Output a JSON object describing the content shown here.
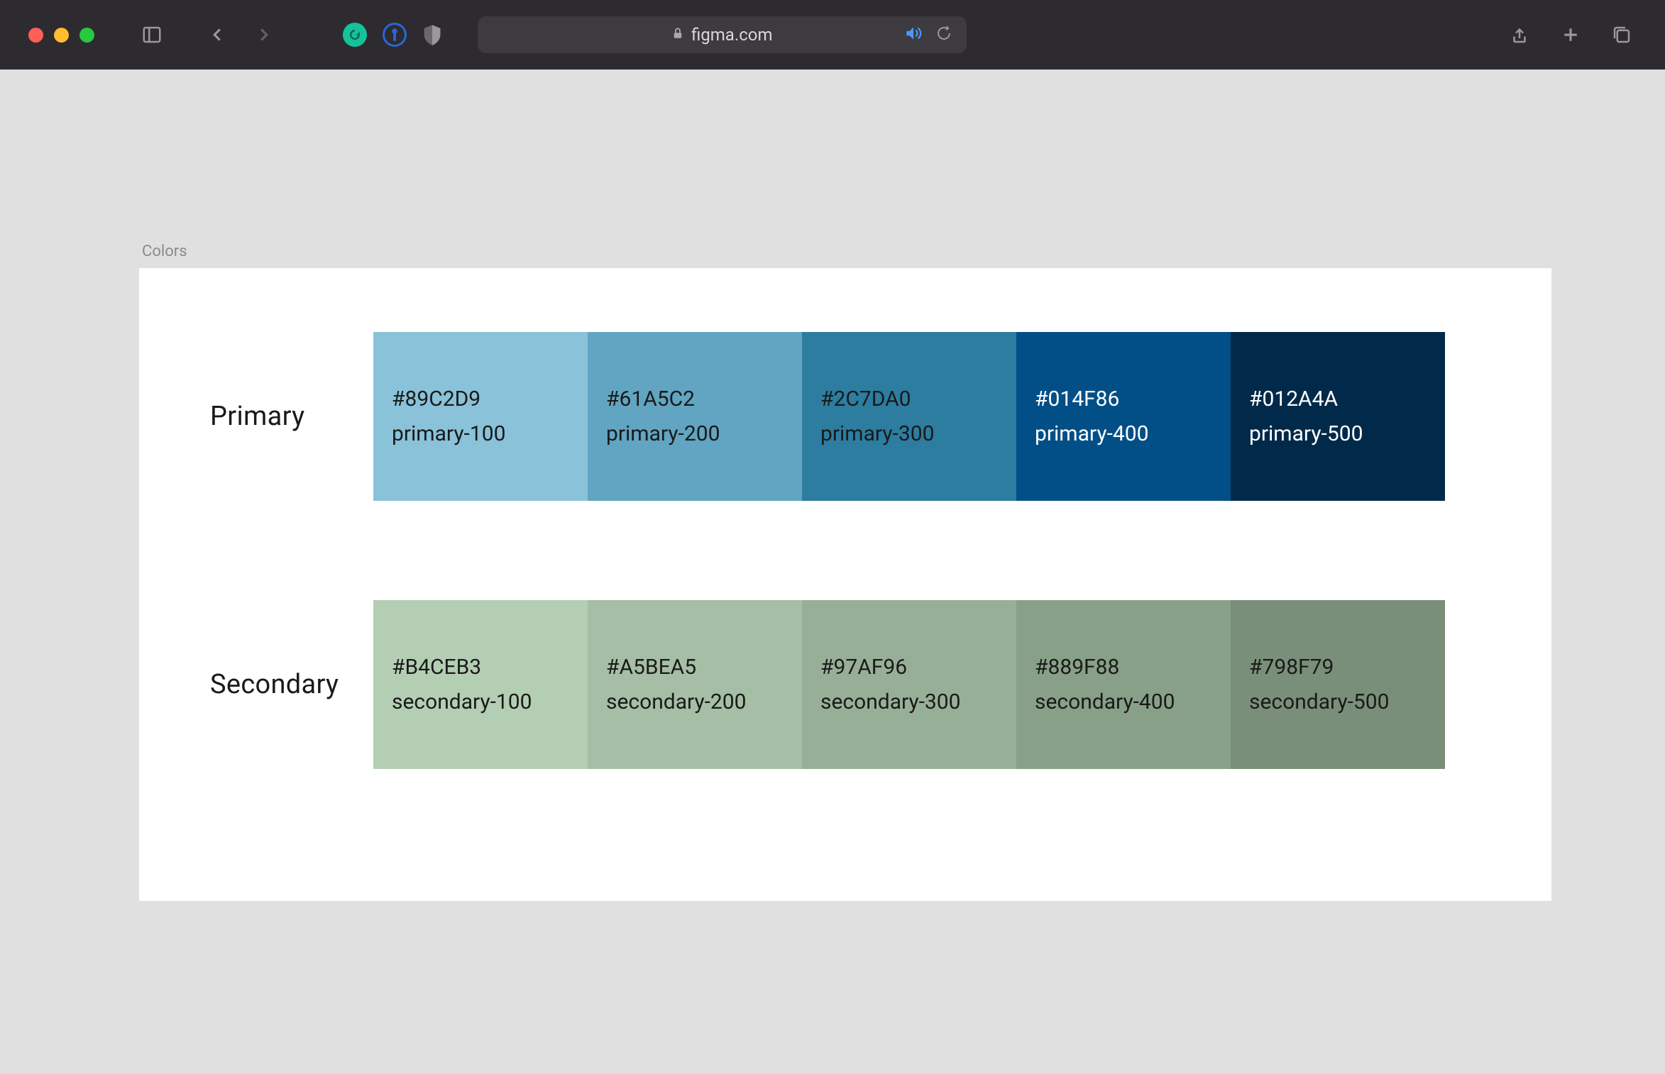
{
  "browser": {
    "url": "figma.com"
  },
  "frame": {
    "label": "Colors"
  },
  "palettes": [
    {
      "label": "Primary",
      "swatches": [
        {
          "hex": "#89C2D9",
          "name": "primary-100",
          "bg": "#89C2D9",
          "text": "dark"
        },
        {
          "hex": "#61A5C2",
          "name": "primary-200",
          "bg": "#61A5C2",
          "text": "dark"
        },
        {
          "hex": "#2C7DA0",
          "name": "primary-300",
          "bg": "#2C7DA0",
          "text": "dark"
        },
        {
          "hex": "#014F86",
          "name": "primary-400",
          "bg": "#014F86",
          "text": "light"
        },
        {
          "hex": "#012A4A",
          "name": "primary-500",
          "bg": "#012A4A",
          "text": "light"
        }
      ]
    },
    {
      "label": "Secondary",
      "swatches": [
        {
          "hex": "#B4CEB3",
          "name": "secondary-100",
          "bg": "#B4CEB3",
          "text": "dark"
        },
        {
          "hex": "#A5BEA5",
          "name": "secondary-200",
          "bg": "#A5BEA5",
          "text": "dark"
        },
        {
          "hex": "#97AF96",
          "name": "secondary-300",
          "bg": "#97AF96",
          "text": "dark"
        },
        {
          "hex": "#889F88",
          "name": "secondary-400",
          "bg": "#889F88",
          "text": "dark"
        },
        {
          "hex": "#798F79",
          "name": "secondary-500",
          "bg": "#798F79",
          "text": "dark"
        }
      ]
    }
  ]
}
